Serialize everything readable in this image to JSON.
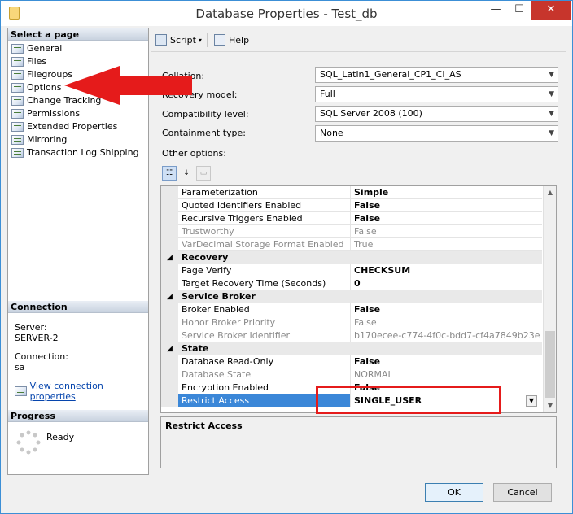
{
  "window": {
    "title": "Database Properties - Test_db",
    "min": "—",
    "max": "☐",
    "close": "✕"
  },
  "left": {
    "select_header": "Select a page",
    "pages": [
      "General",
      "Files",
      "Filegroups",
      "Options",
      "Change Tracking",
      "Permissions",
      "Extended Properties",
      "Mirroring",
      "Transaction Log Shipping"
    ],
    "connection_header": "Connection",
    "server_label": "Server:",
    "server_value": "SERVER-2",
    "connection_label": "Connection:",
    "connection_value": "sa",
    "view_link": "View connection properties",
    "progress_header": "Progress",
    "progress_status": "Ready"
  },
  "toolbar": {
    "script": "Script",
    "help": "Help",
    "script_caret": "▾"
  },
  "form": {
    "collation_label": "Collation:",
    "collation_value": "SQL_Latin1_General_CP1_CI_AS",
    "recovery_label": "Recovery model:",
    "recovery_value": "Full",
    "compat_label": "Compatibility level:",
    "compat_value": "SQL Server 2008 (100)",
    "containment_label": "Containment type:",
    "containment_value": "None",
    "other_options": "Other options:"
  },
  "grid": {
    "rows": [
      {
        "type": "prop",
        "name": "Parameterization",
        "value": "Simple",
        "style": "bold"
      },
      {
        "type": "prop",
        "name": "Quoted Identifiers Enabled",
        "value": "False",
        "style": "bold"
      },
      {
        "type": "prop",
        "name": "Recursive Triggers Enabled",
        "value": "False",
        "style": "bold"
      },
      {
        "type": "prop",
        "name": "Trustworthy",
        "value": "False",
        "style": "ro"
      },
      {
        "type": "prop",
        "name": "VarDecimal Storage Format Enabled",
        "value": "True",
        "style": "ro"
      },
      {
        "type": "cat",
        "name": "Recovery"
      },
      {
        "type": "prop",
        "name": "Page Verify",
        "value": "CHECKSUM",
        "style": "bold"
      },
      {
        "type": "prop",
        "name": "Target Recovery Time (Seconds)",
        "value": "0",
        "style": "bold"
      },
      {
        "type": "cat",
        "name": "Service Broker"
      },
      {
        "type": "prop",
        "name": "Broker Enabled",
        "value": "False",
        "style": "bold"
      },
      {
        "type": "prop",
        "name": "Honor Broker Priority",
        "value": "False",
        "style": "ro"
      },
      {
        "type": "prop",
        "name": "Service Broker Identifier",
        "value": "b170ecee-c774-4f0c-bdd7-cf4a7849b23e",
        "style": "ro"
      },
      {
        "type": "cat",
        "name": "State"
      },
      {
        "type": "prop",
        "name": "Database Read-Only",
        "value": "False",
        "style": "bold"
      },
      {
        "type": "prop",
        "name": "Database State",
        "value": "NORMAL",
        "style": "ro"
      },
      {
        "type": "prop",
        "name": "Encryption Enabled",
        "value": "False",
        "style": "bold"
      },
      {
        "type": "prop",
        "name": "Restrict Access",
        "value": "SINGLE_USER",
        "style": "sel"
      }
    ]
  },
  "description": {
    "title": "Restrict Access"
  },
  "buttons": {
    "ok": "OK",
    "cancel": "Cancel"
  },
  "annotation_color": "#e51b1b"
}
